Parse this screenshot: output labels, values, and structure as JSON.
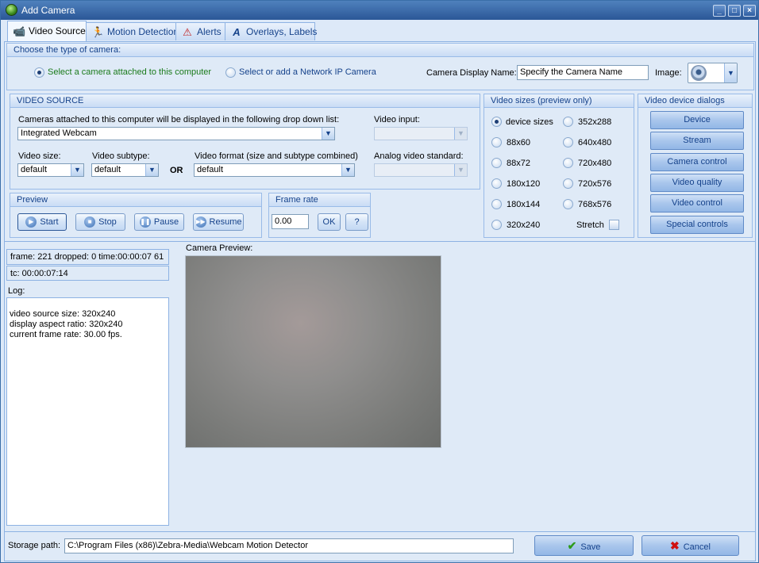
{
  "window": {
    "title": "Add Camera",
    "minimize": "_",
    "maximize": "□",
    "close": "×"
  },
  "tabs": [
    {
      "label": "Video Source",
      "icon": "camera-icon"
    },
    {
      "label": "Motion Detection",
      "icon": "running-man-icon"
    },
    {
      "label": "Alerts",
      "icon": "alert-icon"
    },
    {
      "label": "Overlays, Labels",
      "icon": "text-overlay-icon"
    }
  ],
  "camera_type": {
    "title": "Choose the type of camera:",
    "option_local": "Select a camera attached to this computer",
    "option_ip": "Select or add a Network IP Camera",
    "selected": "local",
    "display_name_label": "Camera Display Name:",
    "display_name_value": "Specify the Camera Name",
    "image_label": "Image:"
  },
  "video_source": {
    "title": "VIDEO SOURCE",
    "cameras_label": "Cameras attached to this computer will be displayed in the following drop down list:",
    "camera_value": "Integrated Webcam",
    "video_input_label": "Video input:",
    "video_input_value": "",
    "video_size_label": "Video size:",
    "video_size_value": "default",
    "video_subtype_label": "Video subtype:",
    "video_subtype_value": "default",
    "or_label": "OR",
    "video_format_label": "Video format (size and subtype combined)",
    "video_format_value": "default",
    "analog_label": "Analog video standard:",
    "analog_value": ""
  },
  "preview": {
    "title": "Preview",
    "start": "Start",
    "stop": "Stop",
    "pause": "Pause",
    "resume": "Resume"
  },
  "frame_rate": {
    "title": "Frame rate",
    "value": "0.00",
    "ok": "OK",
    "help": "?"
  },
  "video_sizes": {
    "title": "Video sizes (preview only)",
    "options": [
      "device sizes",
      "88x60",
      "88x72",
      "180x120",
      "180x144",
      "320x240",
      "352x288",
      "640x480",
      "720x480",
      "720x576",
      "768x576"
    ],
    "selected": "device sizes",
    "stretch_label": "Stretch",
    "stretch_checked": false
  },
  "device_dialogs": {
    "title": "Video device dialogs",
    "buttons": [
      "Device",
      "Stream",
      "Camera control",
      "Video quality",
      "Video control",
      "Special controls"
    ]
  },
  "status": {
    "frame_info": "frame: 221 dropped: 0 time:00:00:07 61",
    "tc": "tc: 00:00:07:14",
    "log_label": "Log:",
    "log_lines": [
      "video source size: 320x240",
      "display aspect ratio: 320x240",
      "current frame rate: 30.00 fps."
    ]
  },
  "camera_preview_label": "Camera Preview:",
  "storage": {
    "label": "Storage path:",
    "value": "C:\\Program Files (x86)\\Zebra-Media\\Webcam Motion Detector"
  },
  "footer": {
    "save": "Save",
    "cancel": "Cancel"
  },
  "colors": {
    "title_bar": "#2b5797",
    "panel_bg": "#dfeaf7",
    "accent_text": "#15428b",
    "radio_green_text": "#1a7a1a",
    "save_check": "#2e9b1a",
    "cancel_x": "#d01010"
  }
}
